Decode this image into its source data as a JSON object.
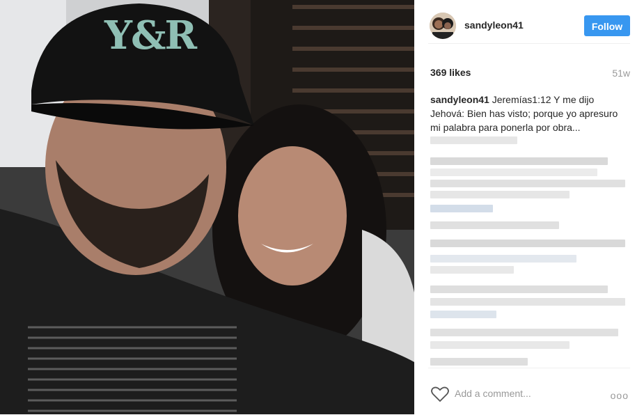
{
  "post": {
    "username": "sandyleon41",
    "follow_label": "Follow",
    "likes": "369 likes",
    "age": "51w",
    "caption_user": "sandyleon41",
    "caption_text": "Jeremías1:12 Y me dijo Jehová: Bien has visto; porque yo apresuro mi palabra para ponerla por obra..."
  },
  "photo": {
    "cap_text": "Y&R"
  },
  "comment_bar": {
    "placeholder": "Add a comment...",
    "more": "ooo"
  },
  "icons": {
    "heart": "heart-icon",
    "more": "more-options-icon"
  },
  "colors": {
    "follow_blue": "#3897f0",
    "muted": "#999999"
  }
}
